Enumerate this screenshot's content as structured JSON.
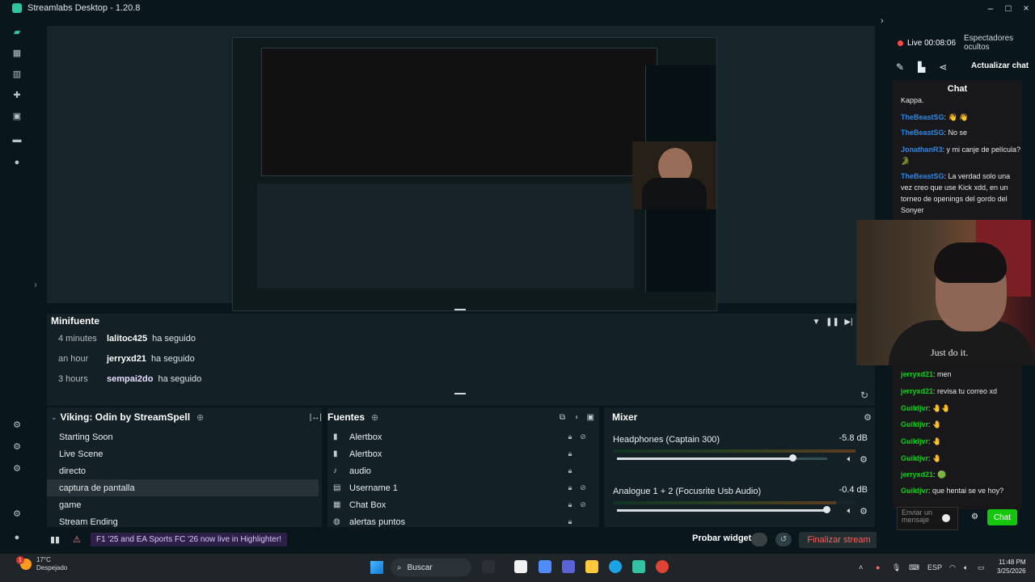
{
  "window": {
    "title": "Streamlabs Desktop - 1.20.8",
    "controls": [
      "–",
      "□",
      "×"
    ]
  },
  "preview": {
    "expand_icon": "chevron-right-icon"
  },
  "minifuente": {
    "title": "Minifuente",
    "events": [
      {
        "time": "4 minutes",
        "user": "lalitoc425",
        "action": "ha seguido"
      },
      {
        "time": "an hour",
        "user": "jerryxd21",
        "action": "ha seguido"
      },
      {
        "time": "3 hours",
        "user": "sempai2do",
        "action": "ha seguido"
      }
    ]
  },
  "scenes": {
    "title": "Viking: Odin by StreamSpell",
    "items": [
      "Starting Soon",
      "Live Scene",
      "directo",
      "captura de pantalla",
      "game",
      "Stream Ending"
    ],
    "selected": "captura de pantalla"
  },
  "sources": {
    "title": "Fuentes",
    "items": [
      {
        "name": "Alertbox",
        "icon": "alertbox-icon"
      },
      {
        "name": "Alertbox",
        "icon": "alertbox-icon"
      },
      {
        "name": "audio",
        "icon": "audio-icon"
      },
      {
        "name": "Username 1",
        "icon": "user-icon"
      },
      {
        "name": "Chat Box",
        "icon": "chat-icon"
      },
      {
        "name": "alertas puntos",
        "icon": "globe-icon"
      }
    ]
  },
  "mixer": {
    "title": "Mixer",
    "tracks": [
      {
        "name": "Headphones (Captain 300)",
        "db": "-5.8 dB",
        "volume": 0.84,
        "meter": 1.0
      },
      {
        "name": "Analogue 1 + 2 (Focusrite Usb Audio)",
        "db": "-0.4 dB",
        "volume": 1.0,
        "meter": 0.92
      }
    ]
  },
  "bottom": {
    "banner": "F1 '25 and EA Sports FC '26 now live in Highlighter!",
    "test_widgets": "Probar widgets",
    "end_stream": "Finalizar stream"
  },
  "right": {
    "live": "Live 00:08:06",
    "viewers": "Espectadores ocultos",
    "refresh_chat": "Actualizar chat",
    "chat_title": "Chat",
    "messages_top": [
      {
        "user": "",
        "text": "Kappa.",
        "color": "plain"
      },
      {
        "user": "TheBeastSG",
        "text": ": 👋 👋",
        "color": "blue"
      },
      {
        "user": "TheBeastSG",
        "text": ": No se",
        "color": "blue"
      },
      {
        "user": "JonathanR3",
        "text": ": y mi canje de película? 🐊",
        "color": "blue"
      },
      {
        "user": "TheBeastSG",
        "text": ": La verdad solo una vez creo que use Kick xdd, en un torneo de openings del gordo del Sonyer",
        "color": "blue"
      }
    ],
    "messages_bottom": [
      {
        "user": "jerryxd21",
        "text": ": men",
        "color": "green"
      },
      {
        "user": "jerryxd21",
        "text": ": revisa tu correo xd",
        "color": "green"
      },
      {
        "user": "Guildjvr",
        "text": ": 🤚🤚",
        "color": "green"
      },
      {
        "user": "Guildjvr",
        "text": ": 🤚",
        "color": "green"
      },
      {
        "user": "Guildjvr",
        "text": ": 🤚",
        "color": "green"
      },
      {
        "user": "Guildjvr",
        "text": ": 🤚",
        "color": "green"
      },
      {
        "user": "jerryxd21",
        "text": ": 🟢",
        "color": "green"
      },
      {
        "user": "Guildjvr",
        "text": ": que hentai se ve hoy?",
        "color": "green"
      }
    ],
    "input_placeholder": "Enviar un mensaje",
    "chat_button": "Chat"
  },
  "webcam": {
    "shirt_text": "Just do it."
  },
  "taskbar": {
    "weather_temp": "17°C",
    "weather_desc": "Despejado",
    "search": "Buscar",
    "lang": "ESP",
    "time": "11:48 PM",
    "date": "3/25/2026"
  },
  "colors": {
    "accent": "#31c3a2",
    "live_red": "#ff4848",
    "chat_green": "#16c60c",
    "user_blue": "#2e88e8"
  }
}
